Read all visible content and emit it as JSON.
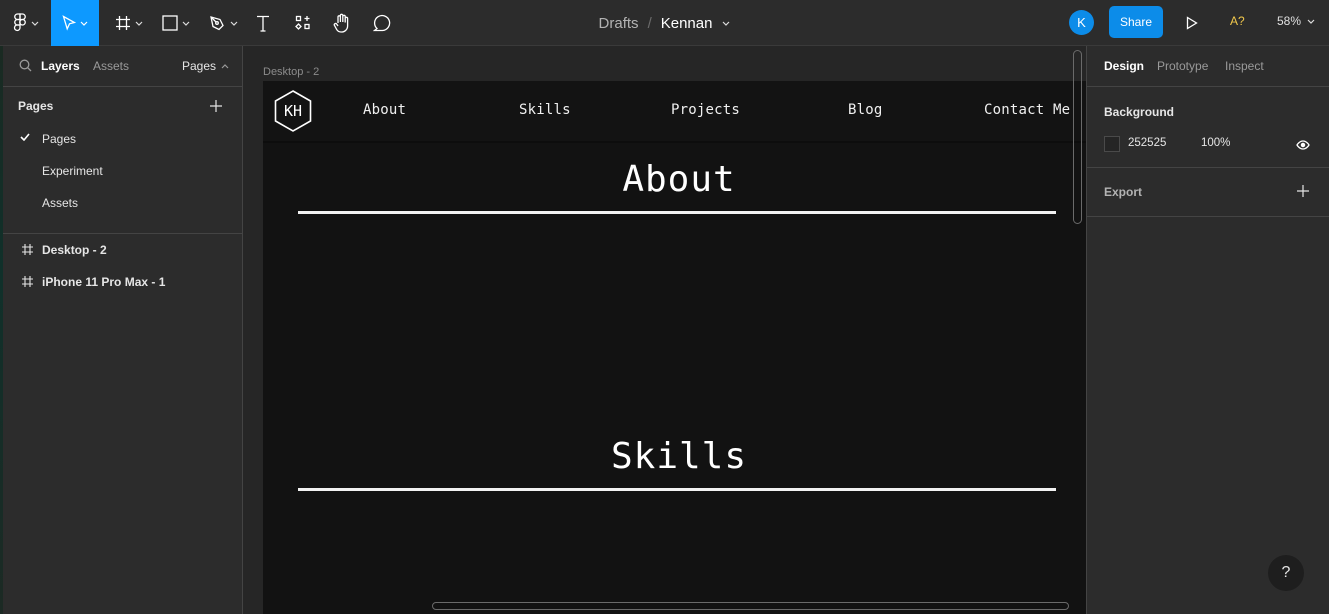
{
  "toolbar": {
    "tools": [
      {
        "name": "main-menu",
        "icon": "figma-logo-icon",
        "has_dropdown": true
      },
      {
        "name": "move-tool",
        "icon": "cursor-arrow-icon",
        "has_dropdown": true,
        "active": true
      },
      {
        "name": "frame-tool",
        "icon": "frame-hash-icon",
        "has_dropdown": true
      },
      {
        "name": "shape-tool",
        "icon": "rectangle-icon",
        "has_dropdown": true
      },
      {
        "name": "pen-tool",
        "icon": "pen-icon",
        "has_dropdown": true
      },
      {
        "name": "text-tool",
        "icon": "text-T-icon",
        "has_dropdown": false
      },
      {
        "name": "resources-tool",
        "icon": "components-icon",
        "has_dropdown": false
      },
      {
        "name": "hand-tool",
        "icon": "hand-icon",
        "has_dropdown": false
      },
      {
        "name": "comment-tool",
        "icon": "comment-bubble-icon",
        "has_dropdown": false
      }
    ],
    "breadcrumb": {
      "parent": "Drafts",
      "separator": "/",
      "current": "Kennan"
    },
    "avatar_initial": "K",
    "share_label": "Share",
    "present_icon": "play-icon",
    "missing_fonts_label": "A?",
    "zoom_level": "58%",
    "accent_color": "#0d99ff"
  },
  "left_panel": {
    "tabs": {
      "layers": "Layers",
      "assets": "Assets"
    },
    "pages_toggle": "Pages",
    "pages_title": "Pages",
    "pages": [
      {
        "label": "Pages",
        "selected": true
      },
      {
        "label": "Experiment",
        "selected": false
      },
      {
        "label": "Assets",
        "selected": false
      }
    ],
    "layers": [
      {
        "label": "Desktop - 2",
        "icon": "frame-icon"
      },
      {
        "label": "iPhone 11 Pro Max - 1",
        "icon": "frame-icon"
      }
    ]
  },
  "canvas": {
    "frame_label": "Desktop - 2",
    "frame": {
      "logo_text": "KH",
      "nav_links": [
        "About",
        "Skills",
        "Projects",
        "Blog",
        "Contact Me"
      ],
      "sections": [
        {
          "heading": "About"
        },
        {
          "heading": "Skills"
        }
      ]
    }
  },
  "right_panel": {
    "tabs": {
      "design": "Design",
      "prototype": "Prototype",
      "inspect": "Inspect"
    },
    "background": {
      "title": "Background",
      "hex": "252525",
      "opacity": "100%",
      "swatch_color": "#252525"
    },
    "export": {
      "title": "Export"
    }
  },
  "help_label": "?"
}
